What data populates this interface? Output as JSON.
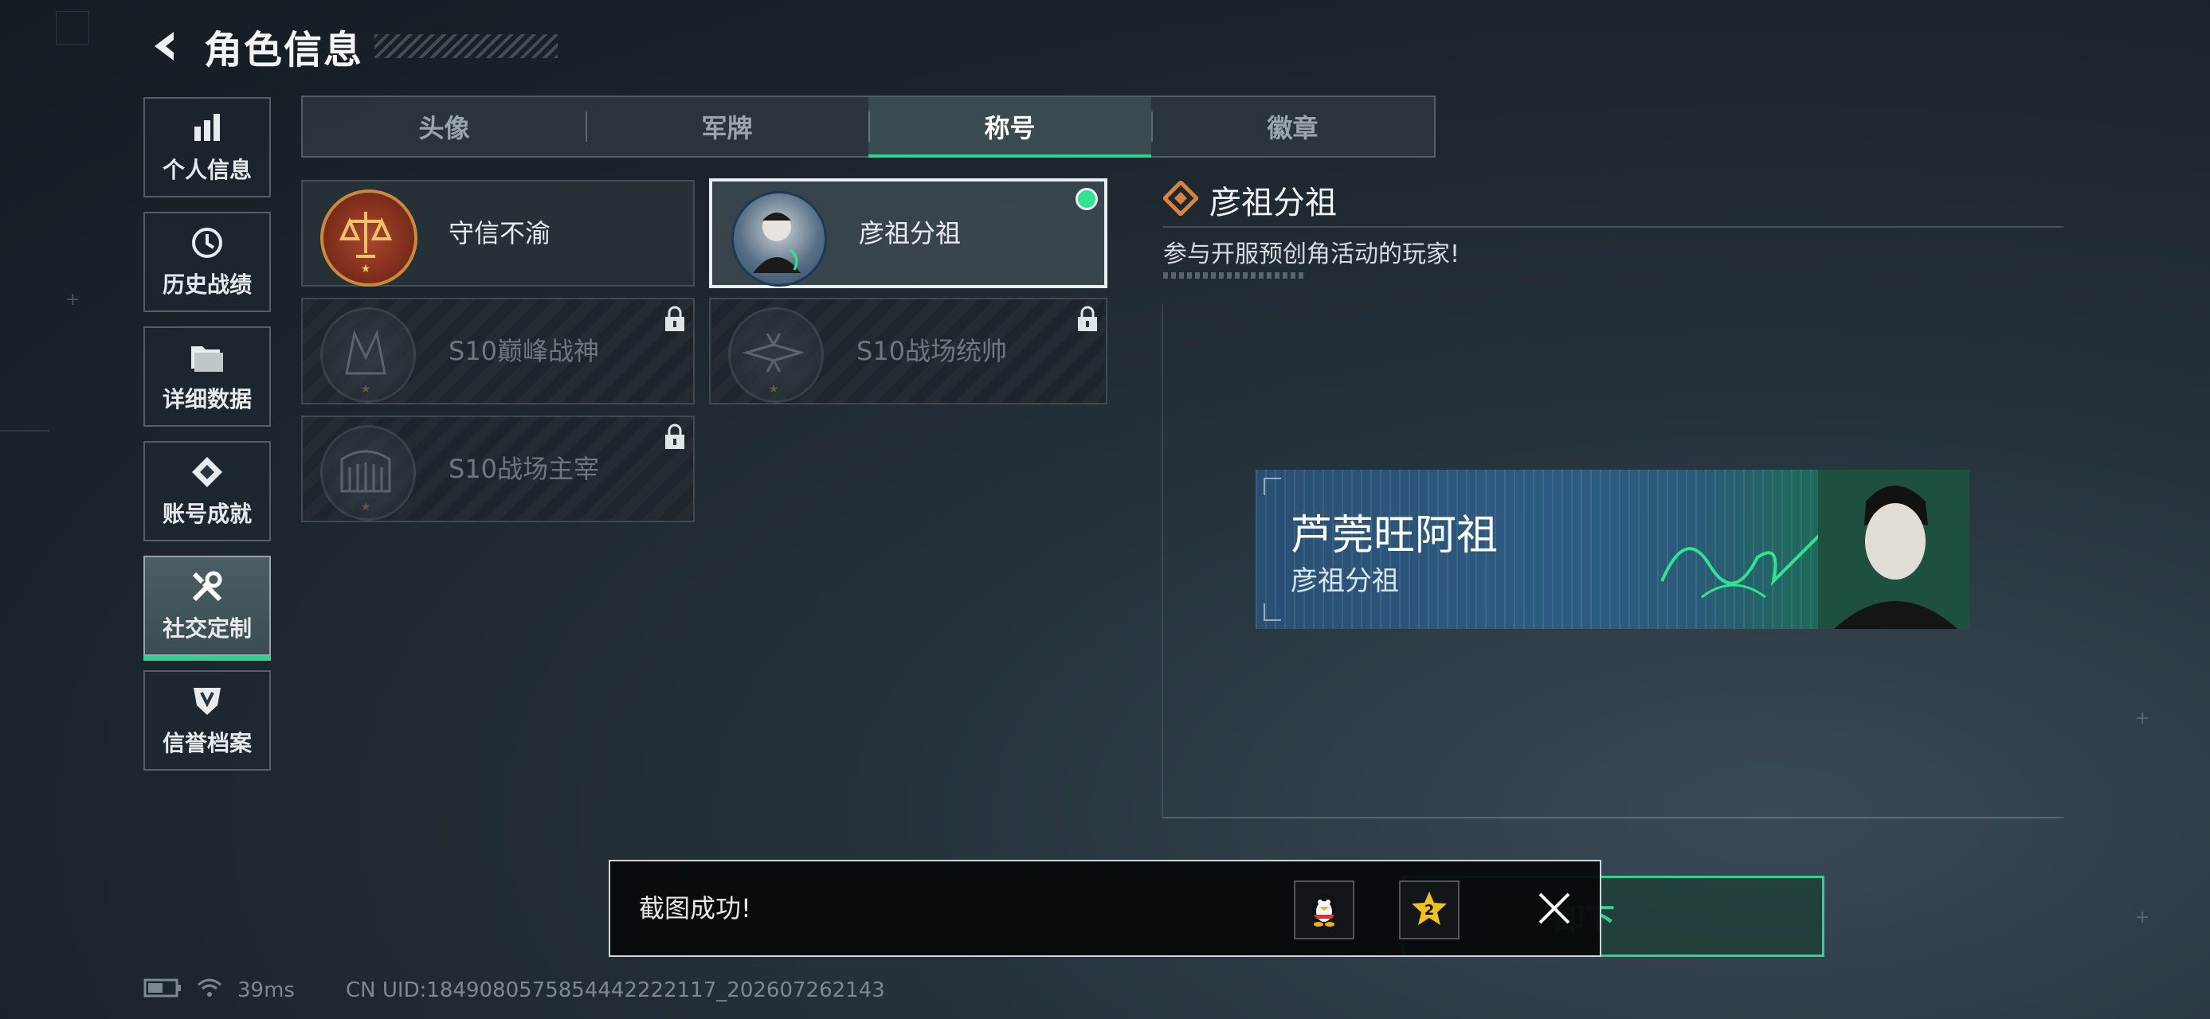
{
  "header": {
    "title": "角色信息"
  },
  "sidebar": {
    "items": [
      {
        "label": "个人信息",
        "icon": "bar-chart-icon"
      },
      {
        "label": "历史战绩",
        "icon": "history-clock-icon"
      },
      {
        "label": "详细数据",
        "icon": "folder-icon"
      },
      {
        "label": "账号成就",
        "icon": "achievement-icon"
      },
      {
        "label": "社交定制",
        "icon": "tools-icon",
        "active": true
      },
      {
        "label": "信誉档案",
        "icon": "shield-badge-icon"
      }
    ]
  },
  "tabs": [
    {
      "label": "头像"
    },
    {
      "label": "军牌"
    },
    {
      "label": "称号",
      "active": true
    },
    {
      "label": "徽章"
    }
  ],
  "titles": [
    {
      "label": "守信不渝",
      "state": "unlocked"
    },
    {
      "label": "彦祖分祖",
      "state": "selected"
    },
    {
      "label": "S10巅峰战神",
      "state": "locked"
    },
    {
      "label": "S10战场统帅",
      "state": "locked"
    },
    {
      "label": "S10战场主宰",
      "state": "locked"
    }
  ],
  "detail": {
    "title": "彦祖分祖",
    "description": "参与开服预创角活动的玩家!"
  },
  "banner": {
    "player_name": "芦莞旺阿祖",
    "title": "彦祖分祖"
  },
  "action": {
    "unload_label": "卸下"
  },
  "toast": {
    "message": "截图成功!",
    "share_targets": [
      "qq-penguin-icon",
      "qzone-star-icon"
    ]
  },
  "status": {
    "ping": "39ms",
    "uid": "CN UID:1849080575854442222117_202607262143"
  },
  "colors": {
    "accent": "#2fd38f",
    "banner_blue": "#2f5b82",
    "banner_green": "#1f6b58"
  }
}
